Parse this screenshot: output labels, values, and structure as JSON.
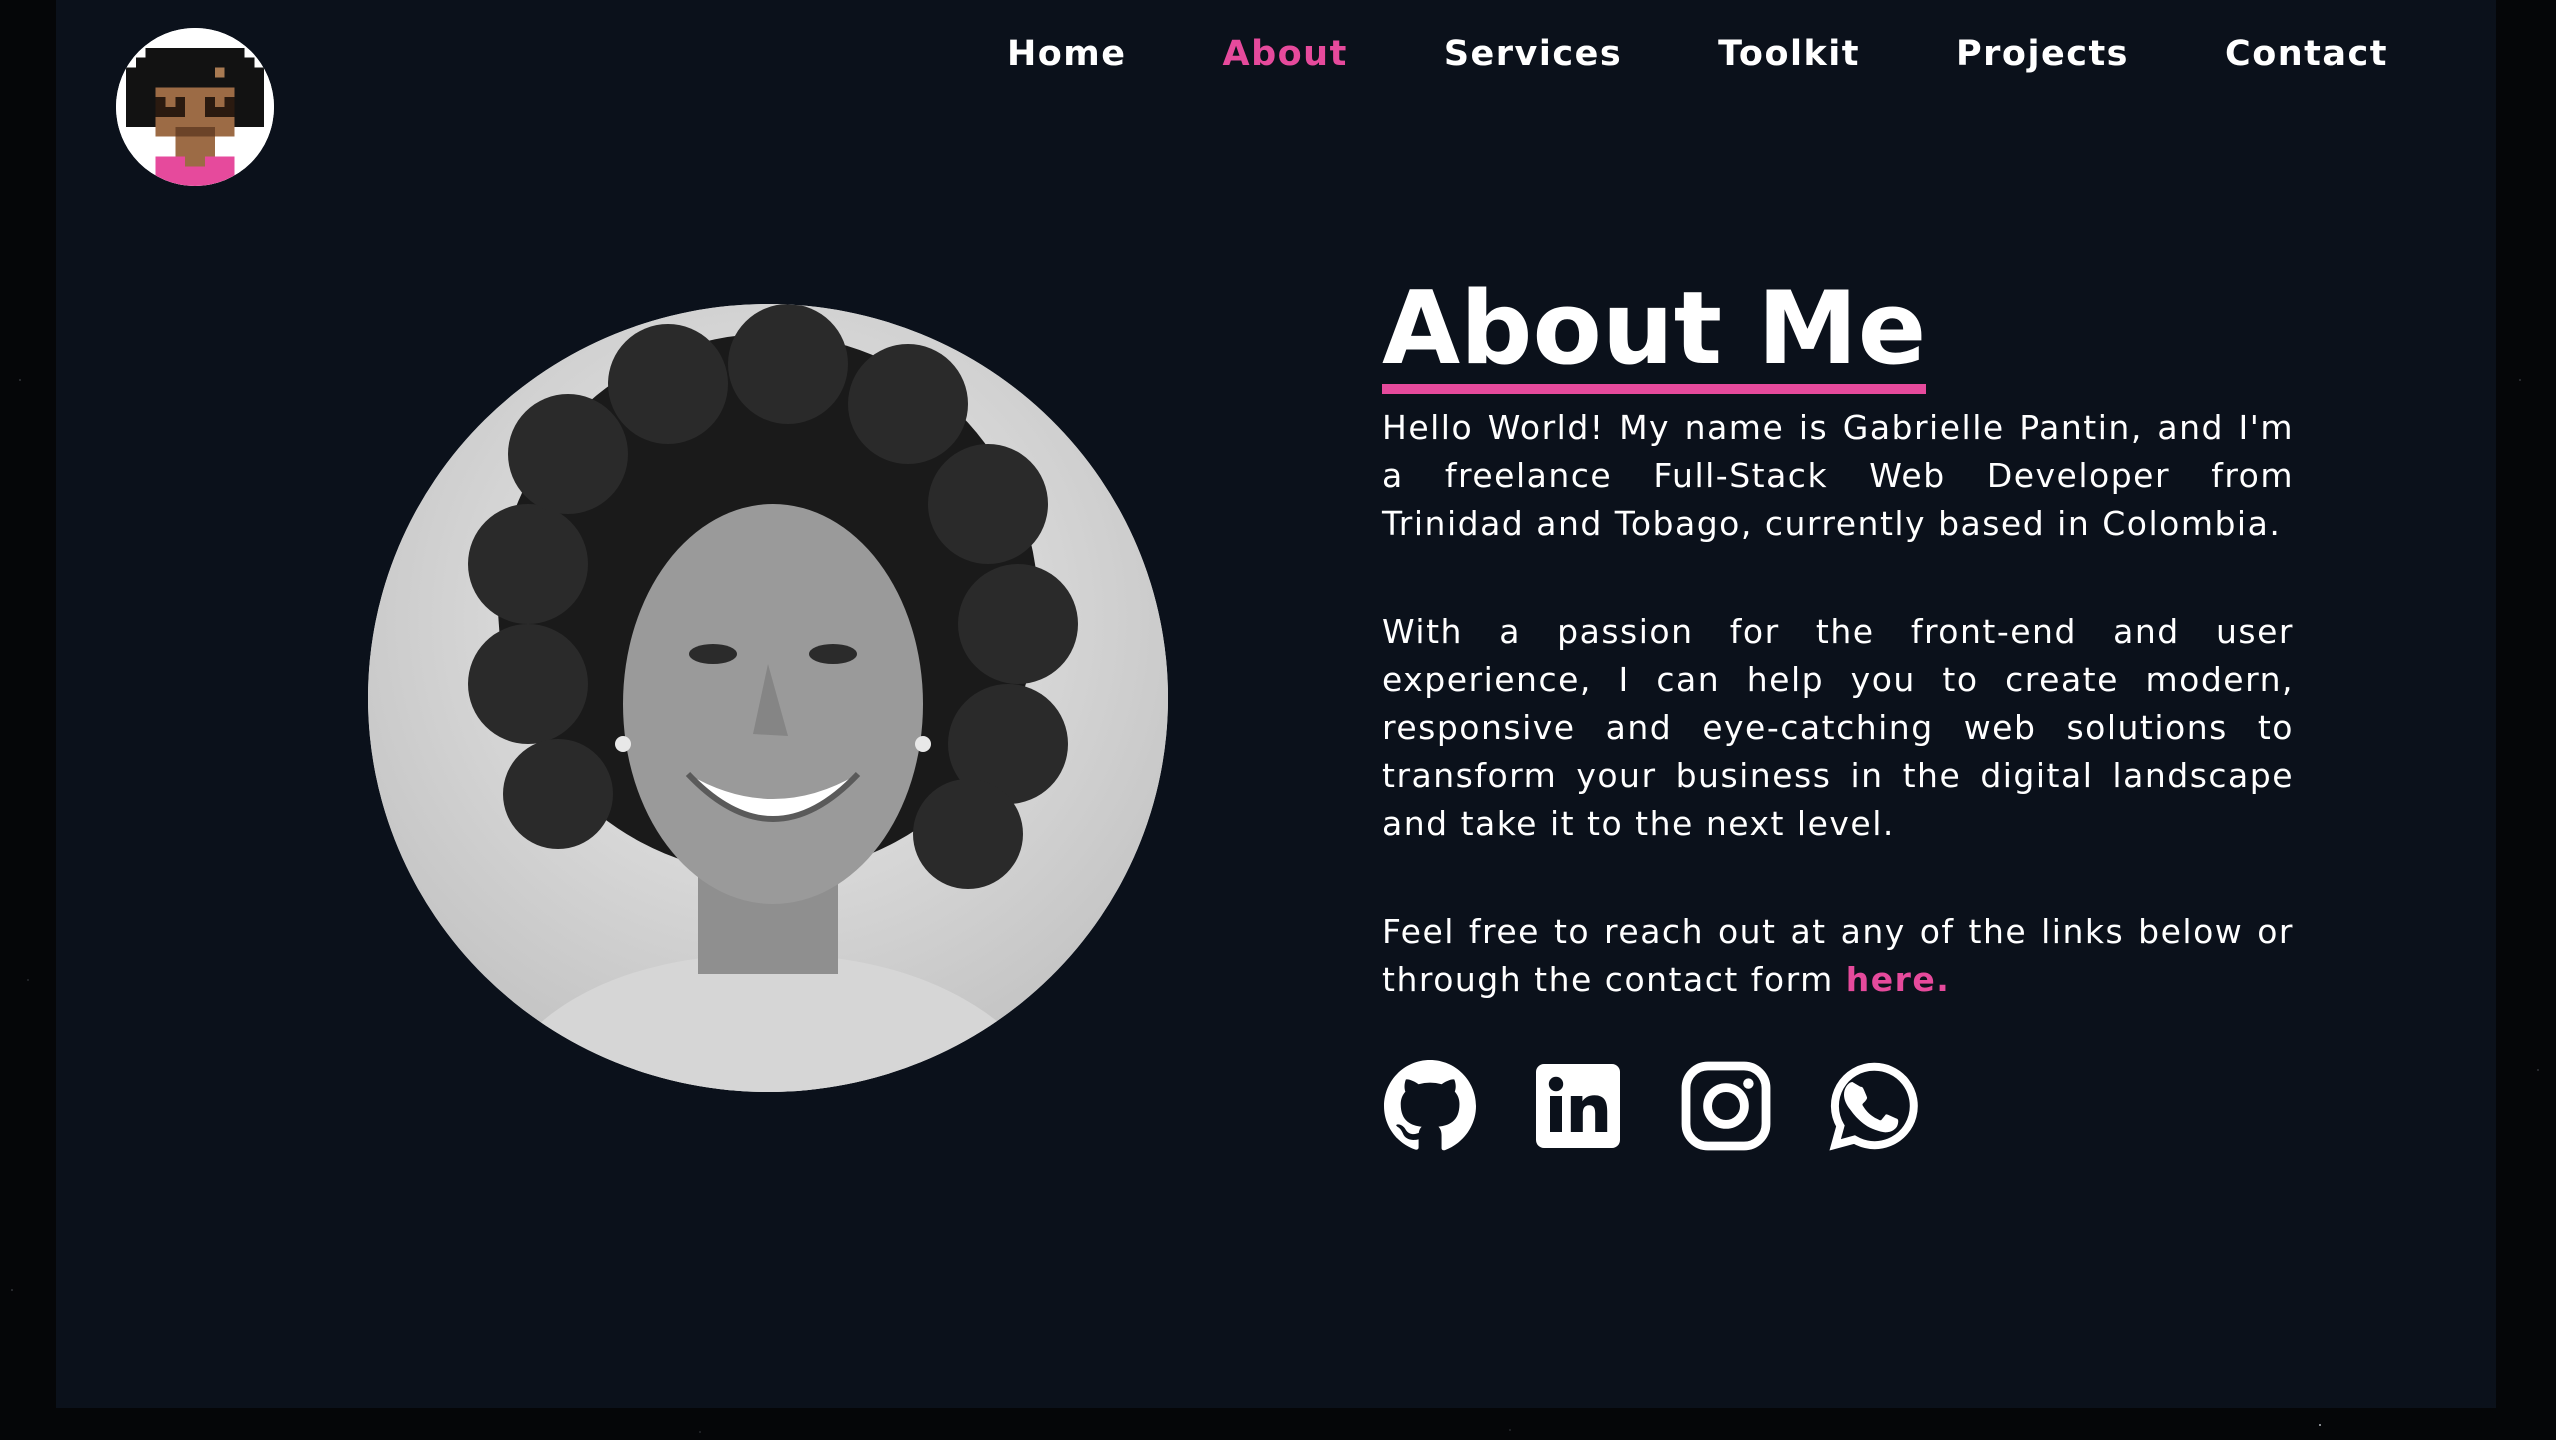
{
  "nav": {
    "items": [
      {
        "label": "Home",
        "active": false
      },
      {
        "label": "About",
        "active": true
      },
      {
        "label": "Services",
        "active": false
      },
      {
        "label": "Toolkit",
        "active": false
      },
      {
        "label": "Projects",
        "active": false
      },
      {
        "label": "Contact",
        "active": false
      }
    ]
  },
  "logo": {
    "icon": "pixel-avatar-icon"
  },
  "portrait": {
    "icon": "profile-photo"
  },
  "about": {
    "title": "About Me",
    "paragraph1": "Hello World! My name is Gabrielle Pantin, and I'm a freelance Full-Stack Web Developer from Trinidad and Tobago, currently based in Colombia.",
    "paragraph2": "With a passion for the front-end and user experience, I can help you to create modern, responsive and eye-catching web solutions to transform your business in the digital landscape and take it to the next level.",
    "paragraph3_prefix": "Feel free to reach out at any of the links below or through the contact form ",
    "paragraph3_link": "here."
  },
  "social": [
    {
      "icon": "github-icon"
    },
    {
      "icon": "linkedin-icon"
    },
    {
      "icon": "instagram-icon"
    },
    {
      "icon": "whatsapp-icon"
    }
  ],
  "colors": {
    "background": "#0b111b",
    "accent": "#e64a9c",
    "text": "#ffffff"
  }
}
